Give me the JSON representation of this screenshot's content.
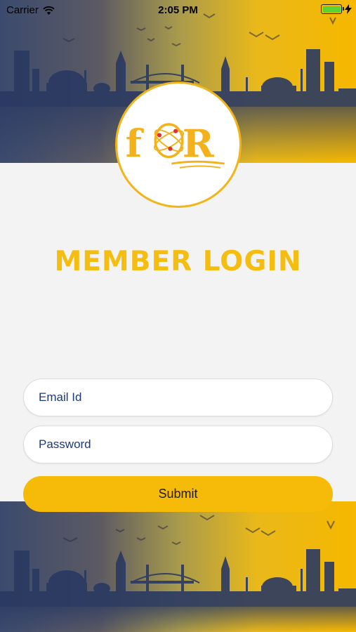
{
  "status_bar": {
    "carrier": "Carrier",
    "time": "2:05 PM",
    "battery_level": 1.0
  },
  "logo": {
    "icon": "for-logo",
    "letter_f": "f",
    "letter_r": "R"
  },
  "page_title": "MEMBER LOGIN",
  "form": {
    "email_placeholder": "Email Id",
    "password_placeholder": "Password",
    "submit_label": "Submit"
  },
  "colors": {
    "accent": "#F4BD0F",
    "field_text": "#1C3A78",
    "background": "#F3F3F3"
  }
}
